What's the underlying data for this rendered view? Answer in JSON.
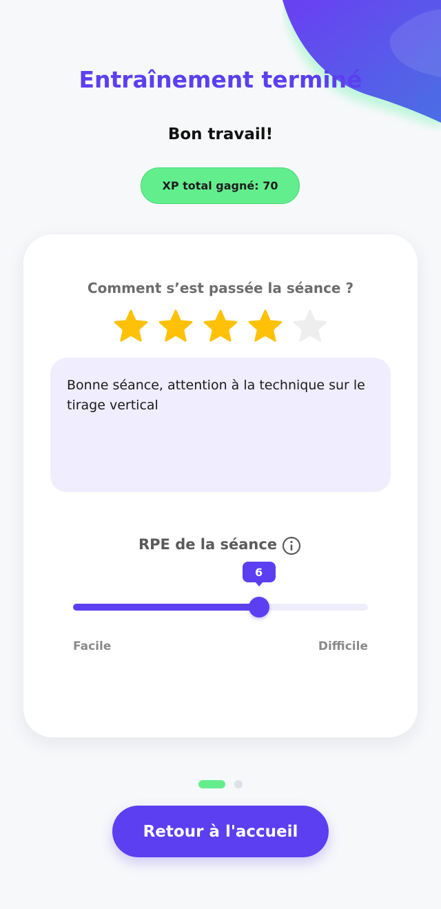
{
  "header": {
    "title": "Entraînement terminé",
    "subtitle": "Bon travail!",
    "xp_badge": "XP total gagné: 70"
  },
  "feedback": {
    "question": "Comment s’est passée la séance ?",
    "rating": 4,
    "rating_max": 5,
    "comment": "Bonne séance, attention à la technique sur le tirage vertical"
  },
  "rpe": {
    "label": "RPE de la séance",
    "value": "6",
    "fraction": 0.63,
    "min_label": "Facile",
    "max_label": "Difficile"
  },
  "pager": {
    "active_index": 0,
    "count": 2
  },
  "actions": {
    "home_button": "Retour à l'accueil"
  },
  "colors": {
    "primary": "#5b3ff0",
    "accent_green": "#63ee8e",
    "star_active": "#ffc107",
    "star_inactive": "#eeeeee",
    "comment_bg": "#efedfe"
  }
}
